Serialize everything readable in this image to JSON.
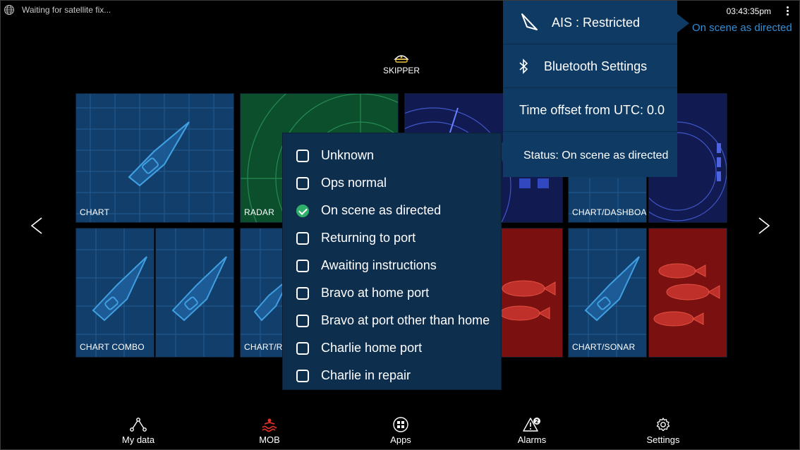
{
  "status_bar": {
    "gps_message": "Waiting for satellite fix...",
    "time": "03:43:35pm",
    "ais_status_text": "On scene as directed"
  },
  "skipper": {
    "label": "SKIPPER",
    "icon": "captain-hat-icon"
  },
  "tiles": [
    {
      "label": "CHART"
    },
    {
      "label": "RADAR"
    },
    {
      "label": "CHART/DASHBOARD"
    },
    {
      "label": "CHART COMBO"
    },
    {
      "label": "CHART/R"
    },
    {
      "label": "CHART/SONAR"
    }
  ],
  "status_menu": {
    "items": [
      {
        "label": "Unknown",
        "checked": false
      },
      {
        "label": "Ops normal",
        "checked": false
      },
      {
        "label": "On scene as directed",
        "checked": true
      },
      {
        "label": "Returning to port",
        "checked": false
      },
      {
        "label": "Awaiting instructions",
        "checked": false
      },
      {
        "label": "Bravo at home port",
        "checked": false
      },
      {
        "label": "Bravo at port other than home",
        "checked": false
      },
      {
        "label": "Charlie home port",
        "checked": false
      },
      {
        "label": "Charlie in repair",
        "checked": false
      }
    ]
  },
  "ais_menu": {
    "ais_label": "AIS : Restricted",
    "bluetooth_label": "Bluetooth Settings",
    "utc_offset_label": "Time offset from UTC: 0.0",
    "status_label": "Status: On scene as directed"
  },
  "bottom_nav": {
    "my_data": "My data",
    "mob": "MOB",
    "apps": "Apps",
    "alarms": "Alarms",
    "alarms_badge": "2",
    "settings": "Settings"
  },
  "colors": {
    "accent_blue": "#2f8fd8",
    "menu_bg": "#0e2e4e",
    "ais_menu_bg": "#0e3a63",
    "check_green": "#2fb06a",
    "mob_red": "#e0302a"
  }
}
